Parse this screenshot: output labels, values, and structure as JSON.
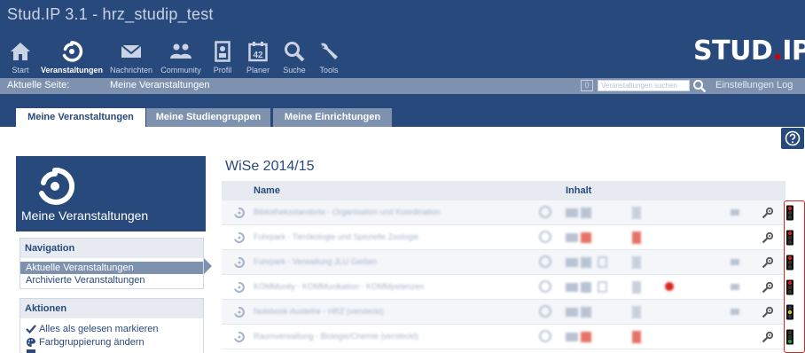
{
  "app": {
    "title": "Stud.IP 3.1 - hrz_studip_test",
    "logo_text": "STUD",
    "logo_dot": ".",
    "logo_tail": "IP"
  },
  "nav": [
    {
      "label": "Start",
      "icon": "home-icon"
    },
    {
      "label": "Veranstaltungen",
      "icon": "seminar-icon",
      "active": true
    },
    {
      "label": "Nachrichten",
      "icon": "mail-icon"
    },
    {
      "label": "Community",
      "icon": "community-icon"
    },
    {
      "label": "Profil",
      "icon": "profile-icon"
    },
    {
      "label": "Planer",
      "icon": "calendar-icon"
    },
    {
      "label": "Suche",
      "icon": "search-icon"
    },
    {
      "label": "Tools",
      "icon": "tools-icon"
    }
  ],
  "breadcrumb": {
    "prefix": "Aktuelle Seite:",
    "page": "Meine Veranstaltungen",
    "badge": "0",
    "search_placeholder": "Veranstaltungen suchen",
    "settings": "Einstellungen",
    "logout": "Log"
  },
  "tabs": [
    {
      "label": "Meine Veranstaltungen",
      "active": true
    },
    {
      "label": "Meine Studiengruppen",
      "active": false
    },
    {
      "label": "Meine Einrichtungen",
      "active": false
    }
  ],
  "sidebar": {
    "title": "Meine Veranstaltungen",
    "navigation": {
      "header": "Navigation",
      "items": [
        {
          "label": "Aktuelle Veranstaltungen",
          "active": true
        },
        {
          "label": "Archivierte Veranstaltungen",
          "active": false
        }
      ]
    },
    "actions": {
      "header": "Aktionen",
      "items": [
        {
          "label": "Alles als gelesen markieren",
          "icon": "checkmark-icon"
        },
        {
          "label": "Farbgruppierung ändern",
          "icon": "palette-icon"
        }
      ]
    }
  },
  "main": {
    "semester": "WiSe 2014/15",
    "columns": {
      "name": "Name",
      "content": "Inhalt"
    },
    "rows": [
      {
        "name": "Bibliotheksstandorte - Organisation und Koordination",
        "status": "red",
        "has_tools": true,
        "red_doc": false,
        "heart": false
      },
      {
        "name": "Fuhrpark - Tierökologie und Spezielle Zoologie",
        "status": "red",
        "has_tools": false,
        "red_doc": true,
        "heart": false
      },
      {
        "name": "Fuhrpark - Verwaltung JLU Gießen",
        "status": "red",
        "has_tools": true,
        "red_doc": false,
        "heart": false
      },
      {
        "name": "KOMMunity - KOMMunikation - KOMMpetenzen",
        "status": "red",
        "has_tools": true,
        "red_doc": false,
        "heart": true
      },
      {
        "name": "Notebook-Ausleihe - HRZ (versteckt)",
        "status": "yellow",
        "has_tools": true,
        "red_doc": false,
        "heart": false
      },
      {
        "name": "Raumverwaltung - Biologie/Chemie (versteckt)",
        "status": "green",
        "has_tools": false,
        "red_doc": true,
        "heart": false
      }
    ]
  },
  "colors": {
    "primary": "#28497c",
    "secondary": "#7e92b0",
    "highlight": "#d9251d"
  }
}
